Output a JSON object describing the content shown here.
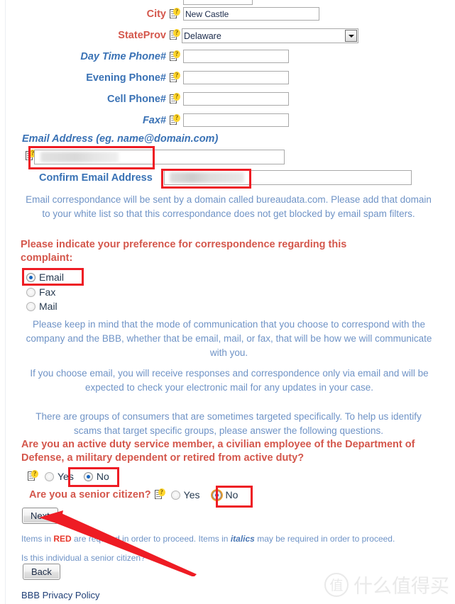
{
  "form": {
    "fields": [
      {
        "label": "City",
        "style": "required",
        "value": "New Castle",
        "type": "text"
      },
      {
        "label": "StateProv",
        "style": "required",
        "value": "Delaware",
        "type": "select"
      },
      {
        "label": "Day Time Phone#",
        "style": "optional-italic",
        "value": "",
        "type": "text"
      },
      {
        "label": "Evening Phone#",
        "style": "optional",
        "value": "",
        "type": "text"
      },
      {
        "label": "Cell Phone#",
        "style": "optional",
        "value": "",
        "type": "text"
      },
      {
        "label": "Fax#",
        "style": "optional-italic",
        "value": "",
        "type": "text"
      }
    ],
    "state_options": [
      "Delaware"
    ],
    "email_heading": "Email Address (eg. name@domain.com)",
    "confirm_email_label": "Confirm Email Address",
    "email_value": "",
    "confirm_email_value": "",
    "email_notice": "Email correspondance will be sent by a domain called bureaudata.com. Please add that domain to your white list so that this correspondance does not get blocked by email spam filters."
  },
  "preference": {
    "heading": "Please indicate your preference for correspondence regarding this complaint:",
    "options": [
      {
        "label": "Email",
        "selected": true
      },
      {
        "label": "Fax",
        "selected": false
      },
      {
        "label": "Mail",
        "selected": false
      }
    ],
    "note_1": "Please keep in mind that the mode of communication that you choose to correspond with the company and the BBB, whether that be email, mail, or fax, that will be how we will communicate with you.",
    "note_2": "If you choose email, you will receive responses and correspondence only via email and will be expected to check your electronic mail for any updates in your case."
  },
  "groups": {
    "intro": "There are groups of consumers that are sometimes targeted specifically. To help us identify scams that target specific groups, please answer the following questions.",
    "military_question": "Are you an active duty service member, a civilian employee of the Department of Defense, a military dependent or retired from active duty?",
    "military_yes": "Yes",
    "military_no": "No",
    "military_answer": "No",
    "senior_question": "Are you a senior citizen?",
    "senior_yes": "Yes",
    "senior_no": "No",
    "senior_answer": "No"
  },
  "actions": {
    "next_label": "Next",
    "back_label": "Back"
  },
  "footnotes": {
    "legend_prefix": "Items in ",
    "legend_red": "RED",
    "legend_mid": " are required in order to proceed. Items in ",
    "legend_italics": "italics",
    "legend_suffix": " may be required in order to proceed.",
    "helper_text": "Is this individual a senior citizen?",
    "privacy_link": "BBB Privacy Policy"
  },
  "watermark": {
    "mark": "值",
    "text": "什么值得买"
  },
  "colors": {
    "required_red": "#d4574c",
    "label_blue": "#3a72b5",
    "body_blue": "#6f93c6",
    "annotation_red": "#ee1c24",
    "radio_dot": "#1565c0",
    "focus_orange": "#f0ab3c"
  }
}
